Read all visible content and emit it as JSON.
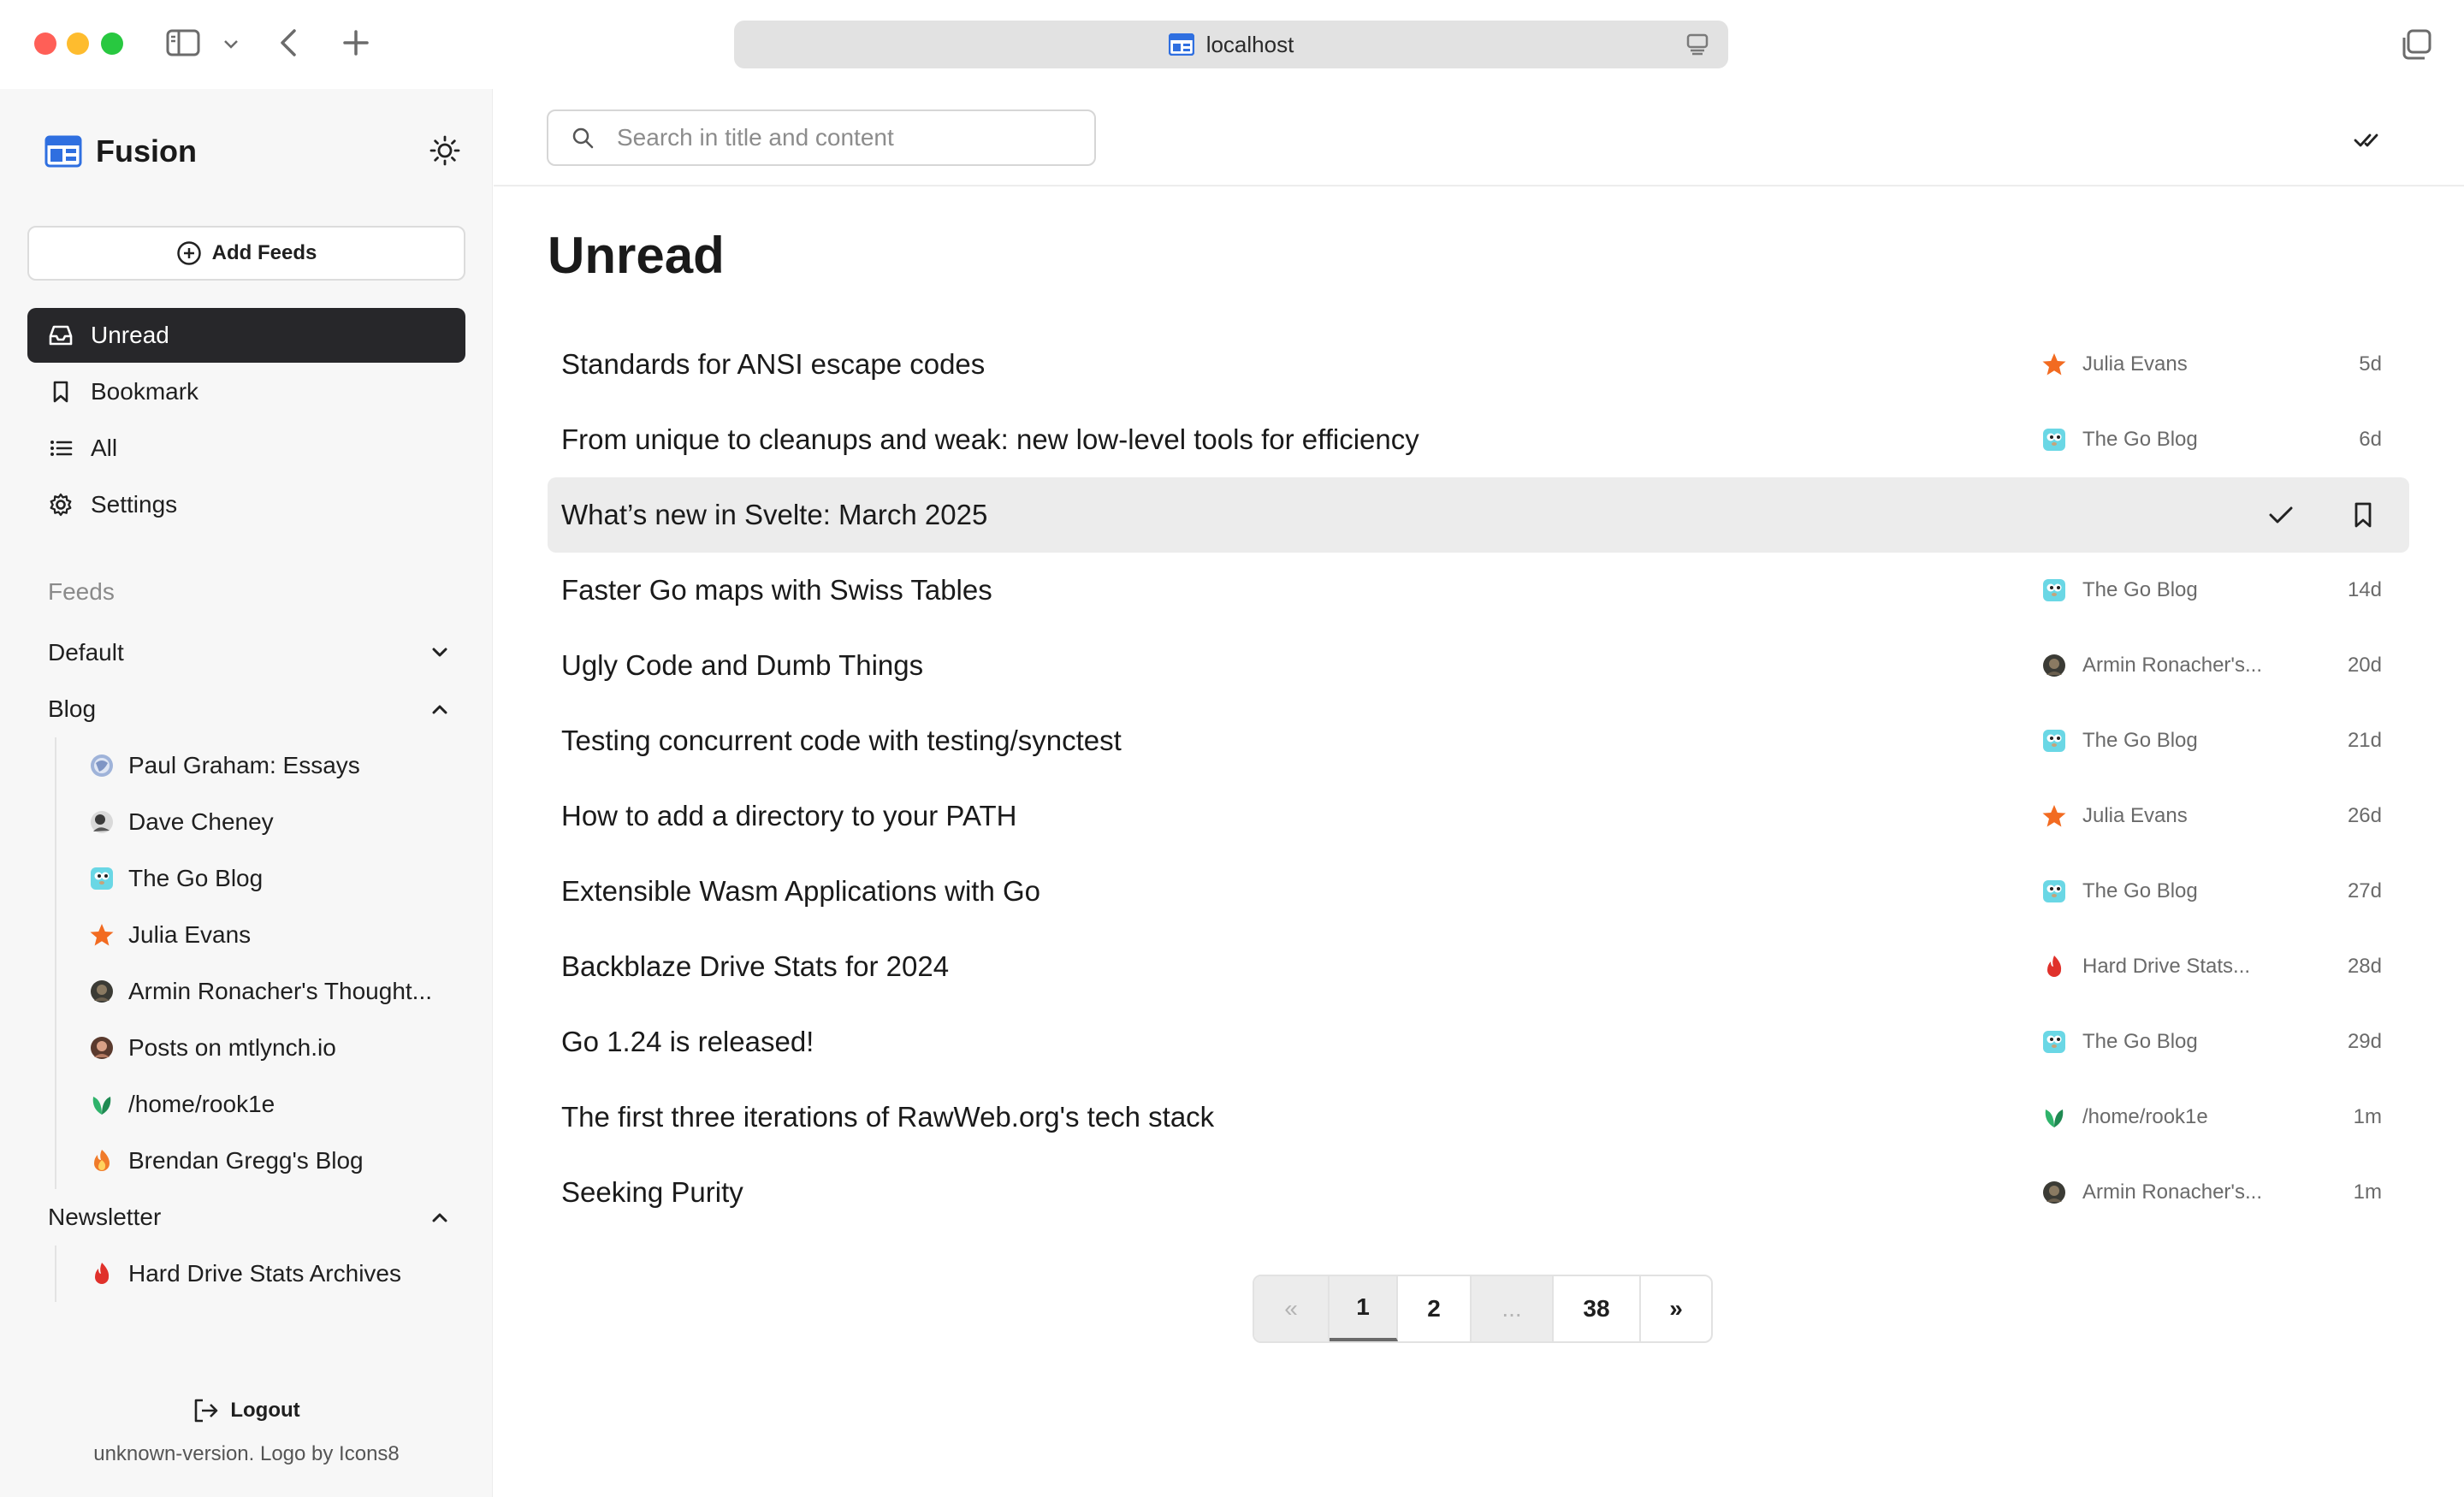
{
  "browser": {
    "address": "localhost"
  },
  "app": {
    "name": "Fusion"
  },
  "sidebar": {
    "add_feeds_label": "Add Feeds",
    "nav": [
      {
        "label": "Unread",
        "icon": "inbox-icon",
        "active": true
      },
      {
        "label": "Bookmark",
        "icon": "bookmark-icon",
        "active": false
      },
      {
        "label": "All",
        "icon": "list-icon",
        "active": false
      },
      {
        "label": "Settings",
        "icon": "gear-icon",
        "active": false
      }
    ],
    "feeds_heading": "Feeds",
    "groups": [
      {
        "name": "Default",
        "expanded": false,
        "feeds": []
      },
      {
        "name": "Blog",
        "expanded": true,
        "feeds": [
          {
            "name": "Paul Graham: Essays",
            "icon": "globe-icon"
          },
          {
            "name": "Dave Cheney",
            "icon": "avatar-icon"
          },
          {
            "name": "The Go Blog",
            "icon": "gopher-icon"
          },
          {
            "name": "Julia Evans",
            "icon": "star-icon"
          },
          {
            "name": "Armin Ronacher's Thought...",
            "icon": "avatar-icon"
          },
          {
            "name": "Posts on mtlynch.io",
            "icon": "avatar-icon"
          },
          {
            "name": "/home/rook1e",
            "icon": "leaf-icon"
          },
          {
            "name": "Brendan Gregg's Blog",
            "icon": "flame-icon"
          }
        ]
      },
      {
        "name": "Newsletter",
        "expanded": true,
        "feeds": [
          {
            "name": "Hard Drive Stats Archives",
            "icon": "flame-icon"
          }
        ]
      }
    ],
    "logout_label": "Logout",
    "version_text": "unknown-version. Logo by Icons8"
  },
  "search": {
    "placeholder": "Search in title and content",
    "value": ""
  },
  "main": {
    "title": "Unread",
    "items": [
      {
        "title": "Standards for ANSI escape codes",
        "source": "Julia Evans",
        "source_icon": "star-icon",
        "age": "5d",
        "hovered": false
      },
      {
        "title": "From unique to cleanups and weak: new low-level tools for efficiency",
        "source": "The Go Blog",
        "source_icon": "gopher-icon",
        "age": "6d",
        "hovered": false
      },
      {
        "title": "What’s new in Svelte: March 2025",
        "source": "",
        "source_icon": "",
        "age": "",
        "hovered": true
      },
      {
        "title": "Faster Go maps with Swiss Tables",
        "source": "The Go Blog",
        "source_icon": "gopher-icon",
        "age": "14d",
        "hovered": false
      },
      {
        "title": "Ugly Code and Dumb Things",
        "source": "Armin Ronacher's...",
        "source_icon": "avatar-icon",
        "age": "20d",
        "hovered": false
      },
      {
        "title": "Testing concurrent code with testing/synctest",
        "source": "The Go Blog",
        "source_icon": "gopher-icon",
        "age": "21d",
        "hovered": false
      },
      {
        "title": "How to add a directory to your PATH",
        "source": "Julia Evans",
        "source_icon": "star-icon",
        "age": "26d",
        "hovered": false
      },
      {
        "title": "Extensible Wasm Applications with Go",
        "source": "The Go Blog",
        "source_icon": "gopher-icon",
        "age": "27d",
        "hovered": false
      },
      {
        "title": "Backblaze Drive Stats for 2024",
        "source": "Hard Drive Stats...",
        "source_icon": "flame-icon",
        "age": "28d",
        "hovered": false
      },
      {
        "title": "Go 1.24 is released!",
        "source": "The Go Blog",
        "source_icon": "gopher-icon",
        "age": "29d",
        "hovered": false
      },
      {
        "title": "The first three iterations of RawWeb.org's tech stack",
        "source": "/home/rook1e",
        "source_icon": "leaf-icon",
        "age": "1m",
        "hovered": false
      },
      {
        "title": "Seeking Purity",
        "source": "Armin Ronacher's...",
        "source_icon": "avatar-icon",
        "age": "1m",
        "hovered": false
      }
    ]
  },
  "pagination": {
    "prev": "«",
    "pages": [
      "1",
      "2"
    ],
    "ellipsis": "...",
    "last": "38",
    "next": "»",
    "current": "1"
  },
  "colors": {
    "active_nav_bg": "#27272a",
    "hover_row_bg": "#ececec",
    "star": "#f26b21",
    "gopher": "#6ad7e5",
    "leaf": "#1f9d55",
    "flame": "#e0312b"
  }
}
